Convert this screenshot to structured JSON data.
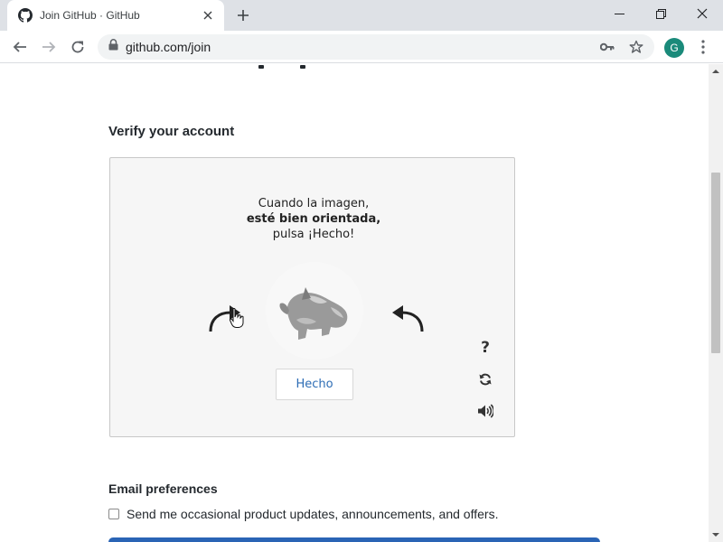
{
  "browser": {
    "tab_title": "Join GitHub · GitHub",
    "url": "github.com/join",
    "profile_initial": "G"
  },
  "page": {
    "verify_title": "Verify your account",
    "captcha": {
      "line1": "Cuando la imagen,",
      "line2": "esté bien orientada,",
      "line3": "pulsa ¡Hecho!",
      "done_label": "Hecho",
      "help_label": "?"
    },
    "email": {
      "title": "Email preferences",
      "checkbox_label": "Send me occasional product updates, announcements, and offers.",
      "checked": false
    }
  },
  "scroll": {
    "position_fraction": 0.35
  },
  "colors": {
    "accent_link": "#2d6db5",
    "primary_button": "#2a64b5",
    "avatar": "#1a8a7a"
  }
}
